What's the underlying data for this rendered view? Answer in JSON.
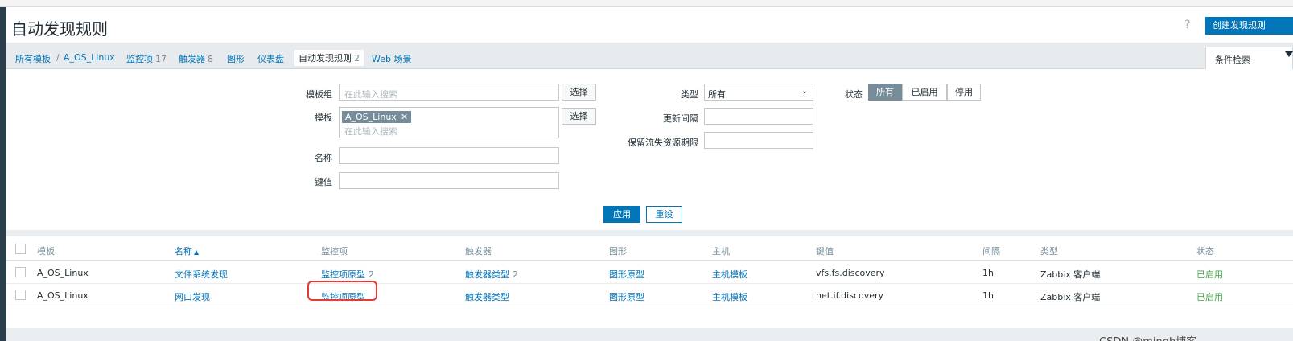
{
  "header": {
    "title": "自动发现规则",
    "help": "?",
    "create_button": "创建发现规则"
  },
  "breadcrumbs": {
    "all_templates": "所有模板",
    "separator": "/",
    "template": "A_OS_Linux",
    "items_label": "监控项",
    "items_count": "17",
    "triggers_label": "触发器",
    "triggers_count": "8",
    "graphs_label": "图形",
    "dashboards_label": "仪表盘",
    "discovery_label": "自动发现规则",
    "discovery_count": "2",
    "web_label": "Web 场景"
  },
  "filter": {
    "tab_label": "条件检索",
    "template_group_label": "模板组",
    "template_group_placeholder": "在此输入搜索",
    "select_button": "选择",
    "template_label": "模板",
    "template_chip": "A_OS_Linux",
    "template_chip_remove": "✕",
    "template_placeholder": "在此输入搜索",
    "name_label": "名称",
    "key_label": "键值",
    "type_label": "类型",
    "type_value": "所有",
    "type_caret": "⌄",
    "update_interval_label": "更新间隔",
    "keep_lost_label": "保留流失资源期限",
    "status_label": "状态",
    "status_options": [
      "所有",
      "已启用",
      "停用"
    ],
    "apply_button": "应用",
    "reset_button": "重设"
  },
  "table": {
    "headers": {
      "template": "模板",
      "name": "名称",
      "sort_arrow": "▲",
      "items": "监控项",
      "triggers": "触发器",
      "graphs": "图形",
      "hosts": "主机",
      "key": "键值",
      "interval": "间隔",
      "type": "类型",
      "status": "状态"
    },
    "rows": [
      {
        "template": "A_OS_Linux",
        "name": "文件系统发现",
        "items": "监控项原型",
        "items_count": "2",
        "triggers": "触发器类型",
        "triggers_count": "2",
        "graphs": "图形原型",
        "hosts": "主机模板",
        "key": "vfs.fs.discovery",
        "interval": "1h",
        "type": "Zabbix 客户端",
        "status": "已启用"
      },
      {
        "template": "A_OS_Linux",
        "name": "网口发现",
        "items": "监控项原型",
        "triggers": "触发器类型",
        "graphs": "图形原型",
        "hosts": "主机模板",
        "key": "net.if.discovery",
        "interval": "1h",
        "type": "Zabbix 客户端",
        "status": "已启用"
      }
    ]
  },
  "watermark": "CSDN @mingh博客",
  "colors": {
    "accent": "#0275b8",
    "ok": "#429e47",
    "highlight": "#e53935"
  }
}
